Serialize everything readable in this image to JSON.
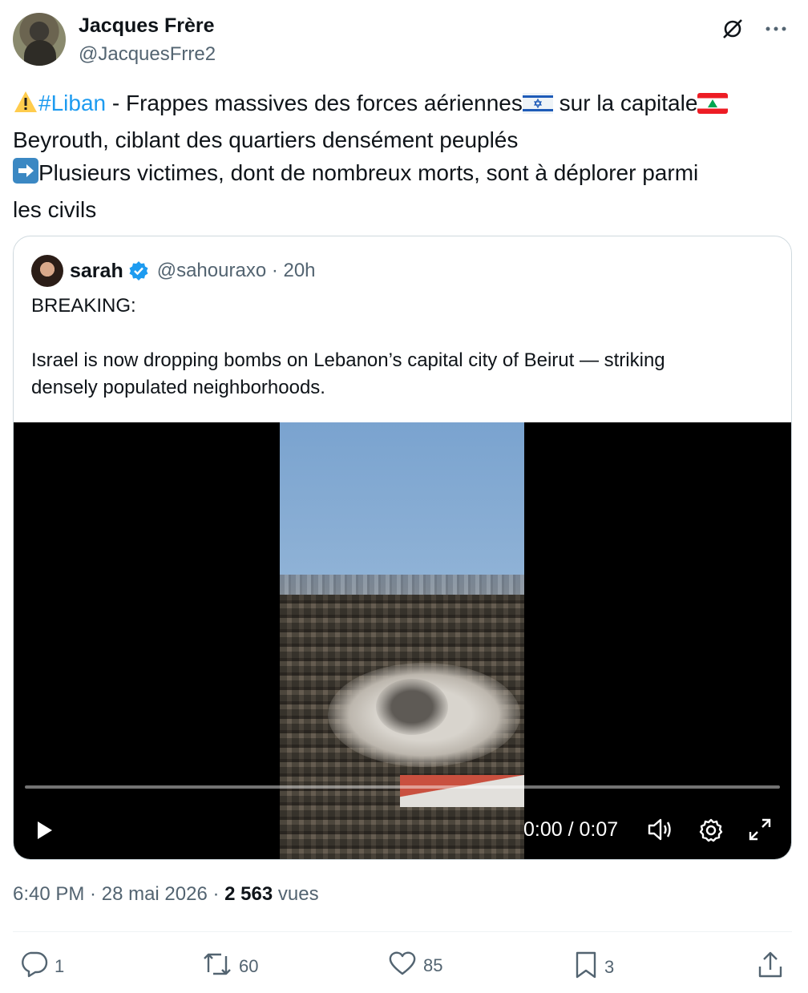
{
  "author": {
    "name": "Jacques Frère",
    "handle": "@JacquesFrre2"
  },
  "header_icons": [
    "grok-icon",
    "more-icon"
  ],
  "tweet": {
    "line1_emoji": "⚠️",
    "hashtag": "#Liban",
    "line1_text_a": " - Frappes massives des forces aériennes",
    "line1_text_b": " sur la capitale",
    "line2": "Beyrouth, ciblant des quartiers densément peuplés",
    "line3_emoji": "➡️",
    "line3": "Plusieurs victimes, dont de nombreux morts, sont à déplorer parmi",
    "line4": "les civils"
  },
  "quoted": {
    "name": "sarah",
    "verified": true,
    "handle_time": "@sahouraxo · 20h",
    "text_line1": "BREAKING:",
    "text_line2": "Israel is now dropping bombs on Lebanon’s capital city of Beirut — striking",
    "text_line3": "densely populated neighborhoods.",
    "video": {
      "time": "0:00 / 0:07",
      "progress": 0
    }
  },
  "meta": {
    "time": "6:40 PM",
    "sep1": " · ",
    "date": "28 mai 2026",
    "sep2": " · ",
    "views_count": "2 563",
    "views_label": " vues"
  },
  "actions": {
    "replies": "1",
    "reposts": "60",
    "likes": "85",
    "bookmarks": "3"
  },
  "colors": {
    "text": "#0f1419",
    "secondary": "#536471",
    "link": "#1d9bf0",
    "border": "#cfd9de",
    "verified": "#1d9bf0"
  }
}
